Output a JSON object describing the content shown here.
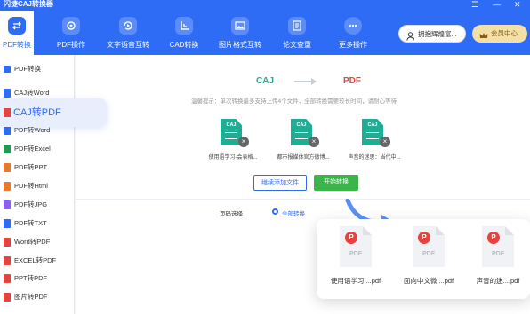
{
  "window": {
    "title": "闪捷CAJ转换器",
    "menu_icon": "menu-icon",
    "minimize": "—",
    "close": "✕"
  },
  "toolbar": {
    "items": [
      {
        "label": "PDF转换",
        "icon": "swap-icon"
      },
      {
        "label": "PDF操作",
        "icon": "gear-icon"
      },
      {
        "label": "文字语音互转",
        "icon": "audio-icon"
      },
      {
        "label": "CAD转换",
        "icon": "cad-icon"
      },
      {
        "label": "图片格式互转",
        "icon": "image-icon"
      },
      {
        "label": "论文查重",
        "icon": "check-doc-icon"
      },
      {
        "label": "更多操作",
        "icon": "more-icon"
      }
    ],
    "user_label": "拥抱辉煌富...",
    "vip_label": "会员中心"
  },
  "sidebar": {
    "items": [
      {
        "label": "PDF转换",
        "color": "#2f6cf5"
      },
      {
        "label": "CAJ转Word",
        "color": "#2f6cf5"
      },
      {
        "label": "CAJ转PDF",
        "color": "#e3443d"
      },
      {
        "label": "PDF转Word",
        "color": "#2f6cf5"
      },
      {
        "label": "PDF转Excel",
        "color": "#1f9a52"
      },
      {
        "label": "PDF转PPT",
        "color": "#e67a2f"
      },
      {
        "label": "PDF转Html",
        "color": "#e67a2f"
      },
      {
        "label": "PDF转JPG",
        "color": "#8b5cf6"
      },
      {
        "label": "PDF转TXT",
        "color": "#2f6cf5"
      },
      {
        "label": "Word转PDF",
        "color": "#e3443d"
      },
      {
        "label": "EXCEL转PDF",
        "color": "#e3443d"
      },
      {
        "label": "PPT转PDF",
        "color": "#e3443d"
      },
      {
        "label": "图片转PDF",
        "color": "#e3443d"
      }
    ]
  },
  "main": {
    "from_format": "CAJ",
    "to_format": "PDF",
    "notice": "温馨提示：单次转换最多支持上传4个文件，全部转换需要较长时间，请耐心等待",
    "files": [
      {
        "tag": "CAJ",
        "name": "使用语学习-会表格..."
      },
      {
        "tag": "CAJ",
        "name": "都市报媒体官方微博..."
      },
      {
        "tag": "CAJ",
        "name": "声音的迷思：当代中..."
      }
    ],
    "add_button": "继续添加文件",
    "start_button": "开始转换",
    "page_label": "页码选择",
    "page_option": "全部转换"
  },
  "popup": {
    "files": [
      {
        "name": "使用语学习....pdf",
        "badge": "P",
        "type": "PDF"
      },
      {
        "name": "面向中文微....pdf",
        "badge": "P",
        "type": "PDF"
      },
      {
        "name": "声音的迷....pdf",
        "badge": "P",
        "type": "PDF"
      }
    ]
  },
  "colors": {
    "primary": "#2f6cf5",
    "caj": "#1fae94",
    "start": "#3bb54a",
    "pdf_red": "#e3443d",
    "vip": "#f3dfa8"
  }
}
